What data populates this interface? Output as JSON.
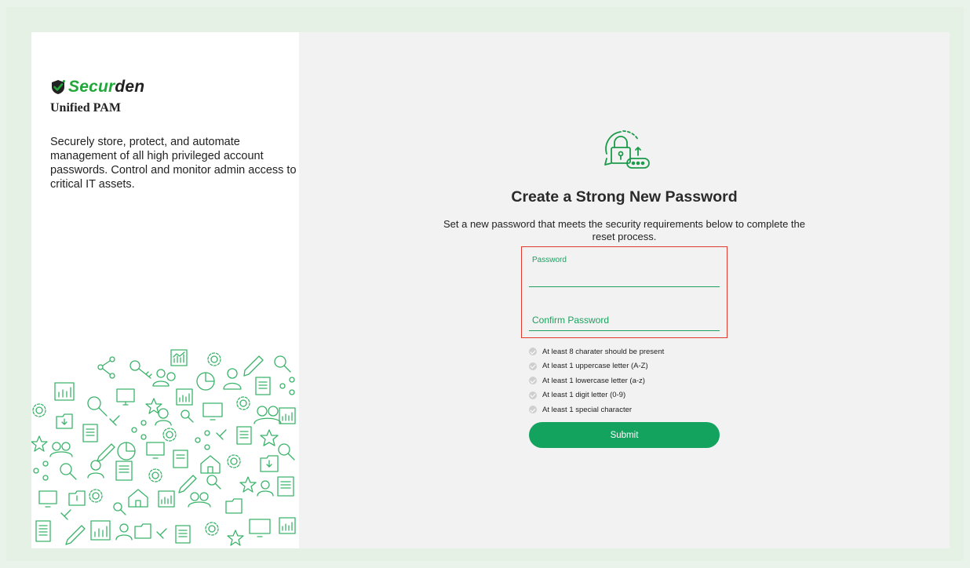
{
  "brand": {
    "name_part1": "Secur",
    "name_part2": "den",
    "product": "Unified PAM",
    "tagline": "Securely store, protect, and automate management of all high privileged account passwords. Control and monitor admin access to critical IT assets."
  },
  "form": {
    "title": "Create a Strong New Password",
    "subtitle": "Set a new password that meets the security requirements below to complete the reset process.",
    "password_label": "Password",
    "confirm_label": "Confirm Password",
    "requirements": [
      "At least 8 charater should be present",
      "At least 1 uppercase letter (A-Z)",
      "At least 1 lowercase letter (a-z)",
      "At least 1 digit letter (0-9)",
      "At least 1 special character"
    ],
    "submit_label": "Submit"
  },
  "icons": [
    "shield-check-icon",
    "lock-password-icon",
    "check-circle-icon",
    "key-icon",
    "gear-icon",
    "share-icon",
    "chart-icon",
    "user-icon",
    "monitor-icon",
    "folder-icon",
    "star-icon",
    "document-icon",
    "home-icon",
    "pie-chart-icon",
    "search-icon",
    "pencil-icon",
    "link-icon"
  ],
  "colors": {
    "brand_green": "#22a83a",
    "accent_green": "#13a35f",
    "highlight_red": "#e03a2f",
    "background": "#eaf3ea"
  }
}
